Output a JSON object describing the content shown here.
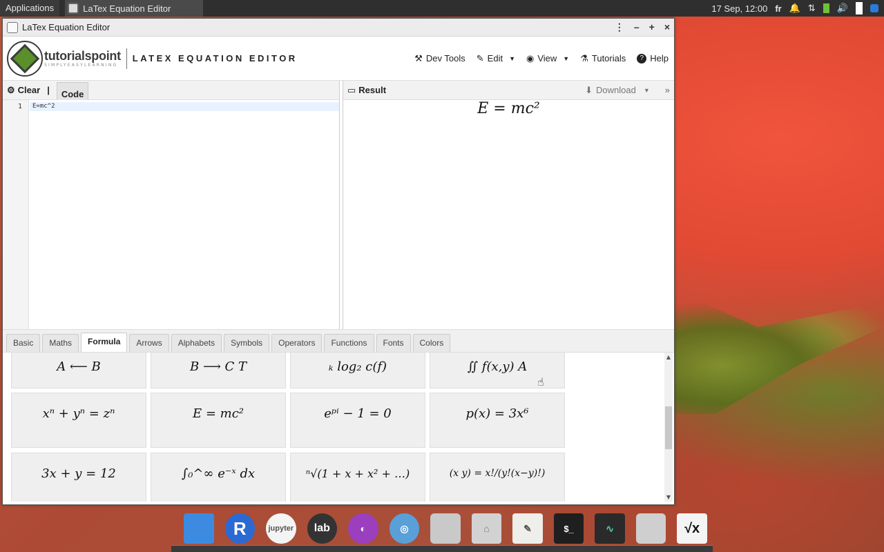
{
  "desktop": {
    "taskbar": {
      "applications": "Applications",
      "task_title": "LaTex Equation Editor",
      "clock": "17 Sep, 12:00",
      "keyboard_layout": "fr"
    }
  },
  "window": {
    "title": "LaTex Equation Editor"
  },
  "header": {
    "brand": "tutorialspoint",
    "tagline": "SIMPLYEASYLEARNING",
    "app_title": "LATEX EQUATION EDITOR",
    "menu": {
      "devtools": "Dev Tools",
      "edit": "Edit",
      "view": "View",
      "tutorials": "Tutorials",
      "help": "Help"
    }
  },
  "editor": {
    "clear": "Clear",
    "separator": "|",
    "code_tab": "Code",
    "line_number": "1",
    "code": "E=mc^2"
  },
  "result": {
    "label": "Result",
    "download": "Download",
    "equation": "E = mc²"
  },
  "tabs": [
    "Basic",
    "Maths",
    "Formula",
    "Arrows",
    "Alphabets",
    "Symbols",
    "Operators",
    "Functions",
    "Fonts",
    "Colors"
  ],
  "active_tab": "Formula",
  "gallery": {
    "row0": [
      "A ⟵ B",
      "B ⟶ C  T",
      "ₖ log₂ c(f)",
      "∬ f(x,y)  A"
    ],
    "row1": [
      "xⁿ + yⁿ = zⁿ",
      "E = mc²",
      "eᵖⁱ − 1 = 0",
      "p(x) = 3x⁶"
    ],
    "row2": [
      "3x + y = 12",
      "∫₀^∞ e⁻ˣ dx",
      "ⁿ√(1 + x + x² + …)",
      "(x y) = x!/(y!(x−y)!)"
    ]
  },
  "dock": [
    "files",
    "R",
    "jupyter",
    "lab",
    "github",
    "chromium",
    "database",
    "home",
    "editor",
    "terminal",
    "monitor",
    "trash",
    "sqrt-x"
  ],
  "colors": {
    "accent": "#5a8f2a",
    "topbar": "#2f2f2f"
  }
}
